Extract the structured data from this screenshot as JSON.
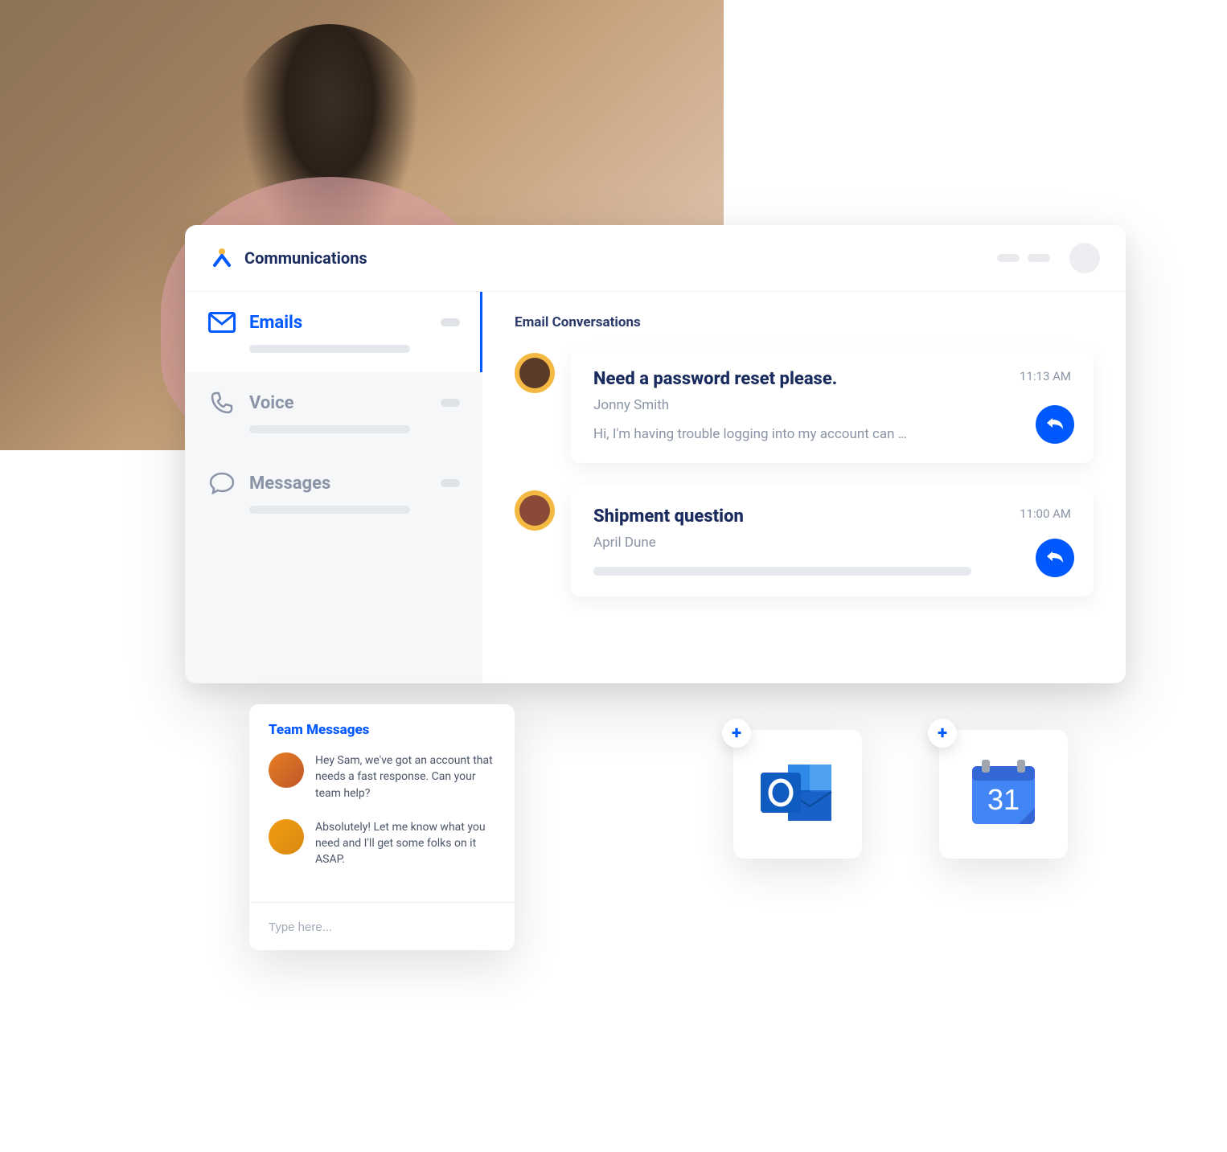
{
  "app": {
    "title": "Communications"
  },
  "sidebar": {
    "items": [
      {
        "label": "Emails"
      },
      {
        "label": "Voice"
      },
      {
        "label": "Messages"
      }
    ]
  },
  "main": {
    "section_title": "Email Conversations",
    "conversations": [
      {
        "subject": "Need a password reset please.",
        "from": "Jonny Smith",
        "time": "11:13 AM",
        "preview": "Hi, I'm having trouble logging into my account can …"
      },
      {
        "subject": "Shipment question",
        "from": "April Dune",
        "time": "11:00 AM",
        "preview": ""
      }
    ]
  },
  "team_messages": {
    "title": "Team Messages",
    "messages": [
      {
        "text": "Hey Sam, we've got an account that needs a fast response. Can your team help?"
      },
      {
        "text": "Absolutely! Let me know what you need and I'll get some folks on it ASAP."
      }
    ],
    "input_placeholder": "Type here..."
  },
  "integrations": {
    "outlook": {
      "name": "Outlook"
    },
    "gcal": {
      "name": "Google Calendar",
      "day": "31"
    }
  },
  "icons": {
    "logo": "x-person-icon",
    "mail": "mail-icon",
    "phone": "phone-icon",
    "chat": "chat-bubble-icon",
    "reply": "reply-icon",
    "plus": "plus-icon"
  },
  "colors": {
    "primary": "#0058ff",
    "heading": "#1a2b5e",
    "muted": "#8a94a6"
  }
}
